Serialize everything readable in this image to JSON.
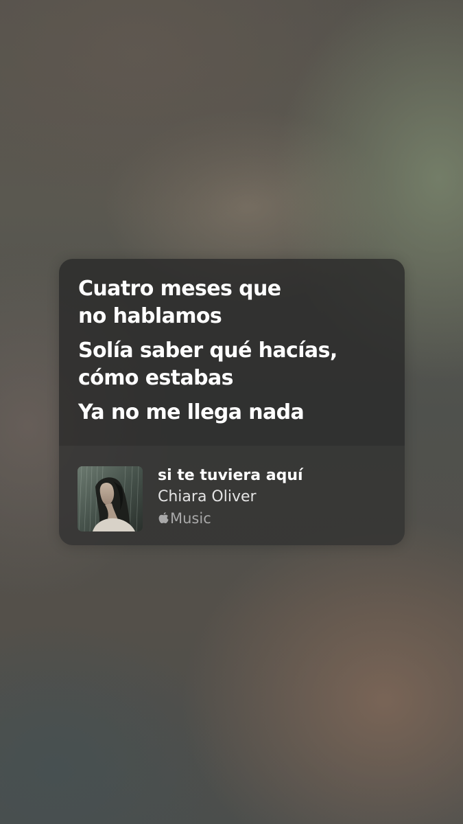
{
  "lyrics": {
    "lines": [
      "Cuatro meses que\nno hablamos",
      "Solía saber qué hacías,\ncómo estabas",
      "Ya no me llega nada"
    ]
  },
  "track": {
    "title": "si te tuviera aquí",
    "artist": "Chiara Oliver",
    "service_icon": "apple-icon",
    "service_label": "Music"
  }
}
